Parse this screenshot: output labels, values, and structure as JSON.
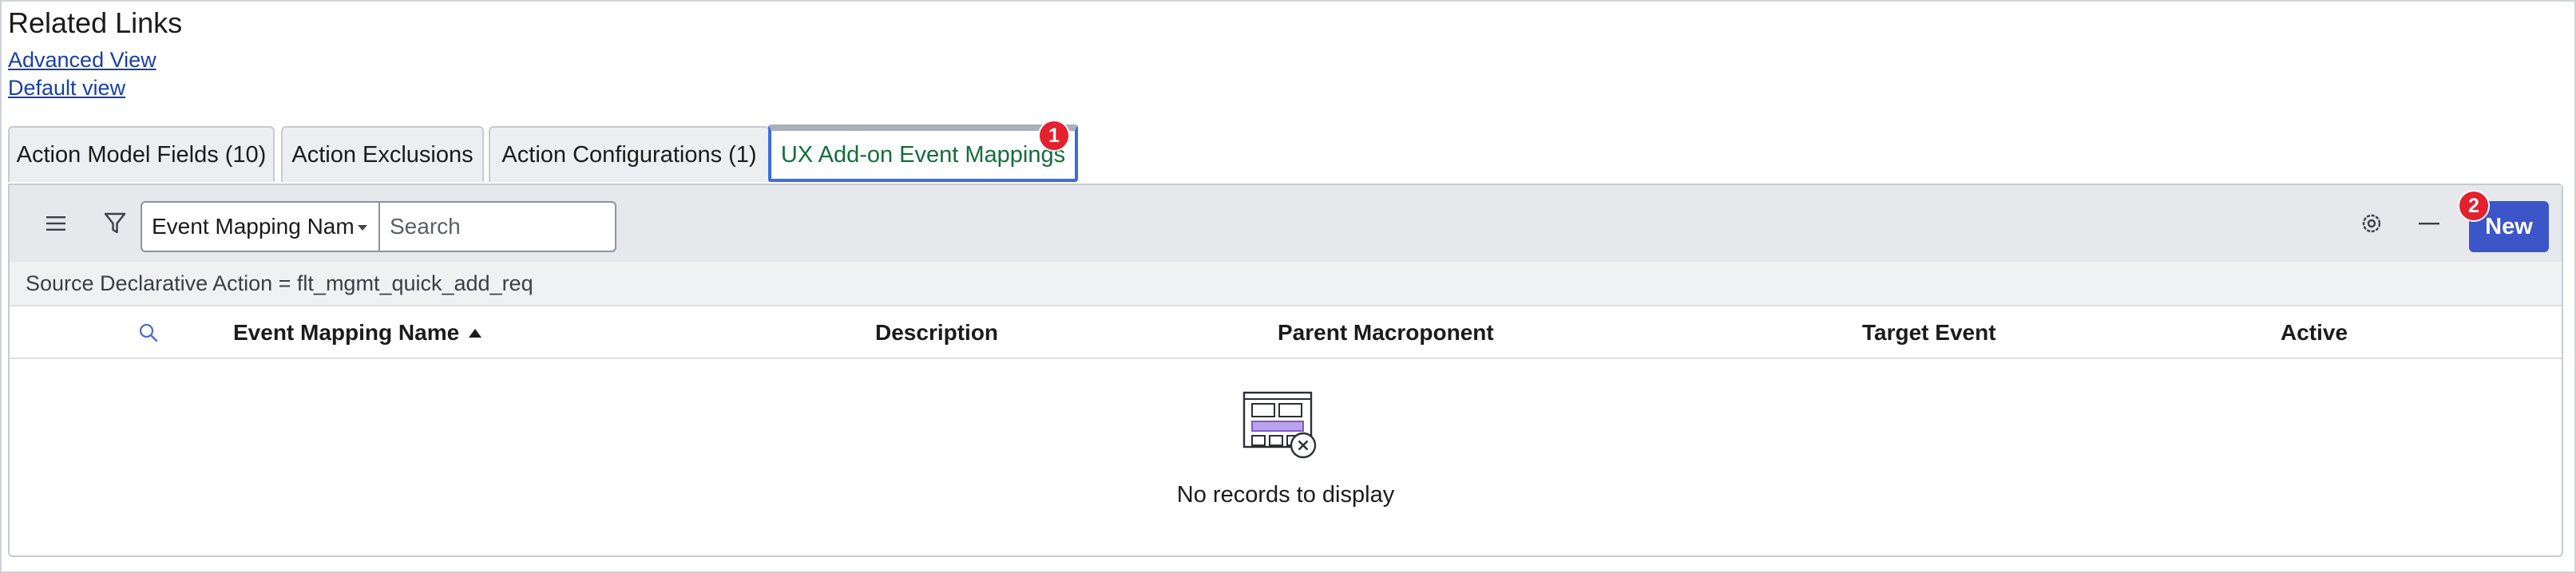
{
  "related_links": {
    "title": "Related Links",
    "links": [
      "Advanced View",
      "Default view"
    ]
  },
  "tabs": [
    {
      "label": "Action Model Fields (10)"
    },
    {
      "label": "Action Exclusions"
    },
    {
      "label": "Action Configurations (1)"
    },
    {
      "label": "UX Add-on Event Mappings",
      "active": true
    }
  ],
  "badges": {
    "first": "1",
    "second": "2"
  },
  "toolbar": {
    "menu_icon": "hamburger-menu-icon",
    "filter_icon": "funnel-filter-icon",
    "field_select_value": "Event Mapping Nam",
    "search_placeholder": "Search",
    "settings_icon": "gear-icon",
    "minimize_icon": "minus-icon",
    "new_label": "New"
  },
  "breadcrumb": "Source Declarative Action = flt_mgmt_quick_add_req",
  "table": {
    "columns": [
      "Event Mapping Name",
      "Description",
      "Parent Macroponent",
      "Target Event",
      "Active"
    ],
    "sorted_column": "Event Mapping Name",
    "sort_direction": "ascending",
    "empty_message": "No records to display"
  },
  "colors": {
    "accent": "#3c55c9",
    "active_tab_text": "#126e3b",
    "active_tab_border": "#3c6be3",
    "badge": "#e3212f",
    "link": "#1a3fa8"
  }
}
